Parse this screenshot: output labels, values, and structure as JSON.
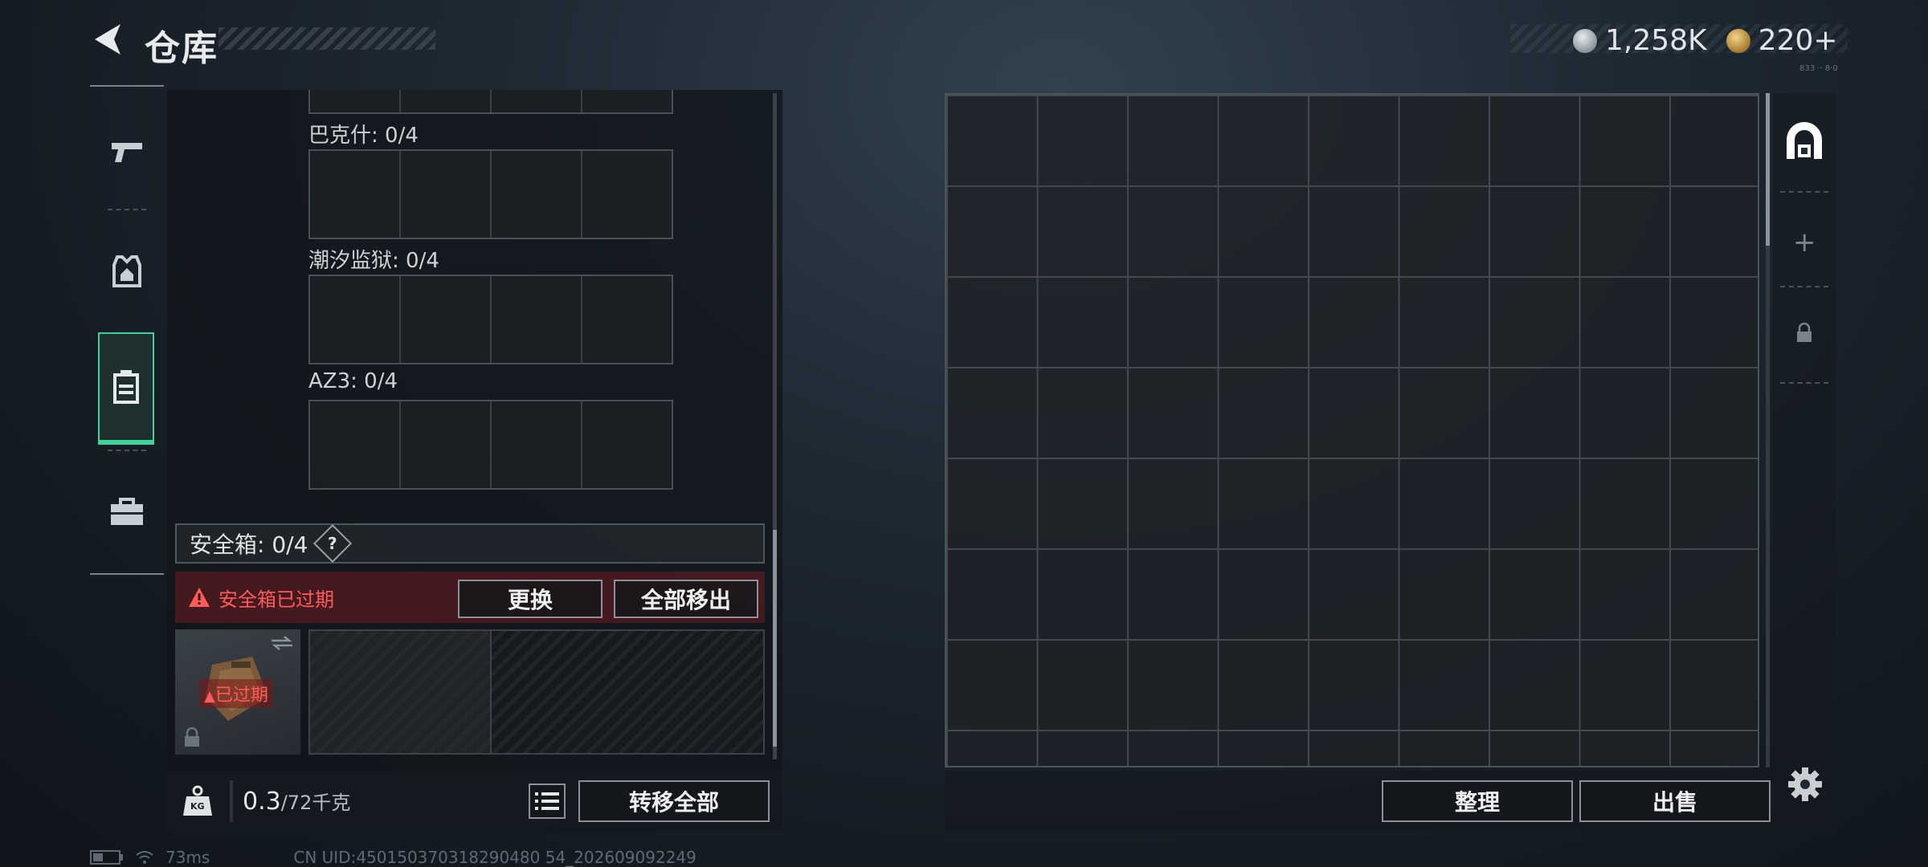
{
  "header": {
    "title": "仓库",
    "currency1": "1,258K",
    "currency2": "220+",
    "small_tag": "833 ·· 8·0"
  },
  "left_tabs": [
    {
      "name": "weapon"
    },
    {
      "name": "armor"
    },
    {
      "name": "backpack",
      "selected": true
    },
    {
      "name": "toolbox"
    }
  ],
  "slots": [
    {
      "label": "巴克什: 0/4"
    },
    {
      "label": "潮汐监狱: 0/4"
    },
    {
      "label": "AZ3: 0/4"
    }
  ],
  "safe_box": {
    "title": "安全箱: 0/4",
    "help": "?",
    "warning": "安全箱已过期",
    "replace_label": "更换",
    "move_all_label": "全部移出",
    "expired_tag": "已过期"
  },
  "bottom_left": {
    "weight_current": "0.3",
    "weight_max": "/72千克",
    "kg_badge": "KG",
    "transfer_all_label": "转移全部"
  },
  "bottom_right": {
    "sort_label": "整理",
    "sell_label": "出售"
  },
  "status_bar": {
    "ping": "73ms",
    "uid": "CN UID:450150370318290480 54_202609092249"
  },
  "colors": {
    "accent_green": "#3fd29a",
    "warning_red": "#ff5a5a"
  }
}
